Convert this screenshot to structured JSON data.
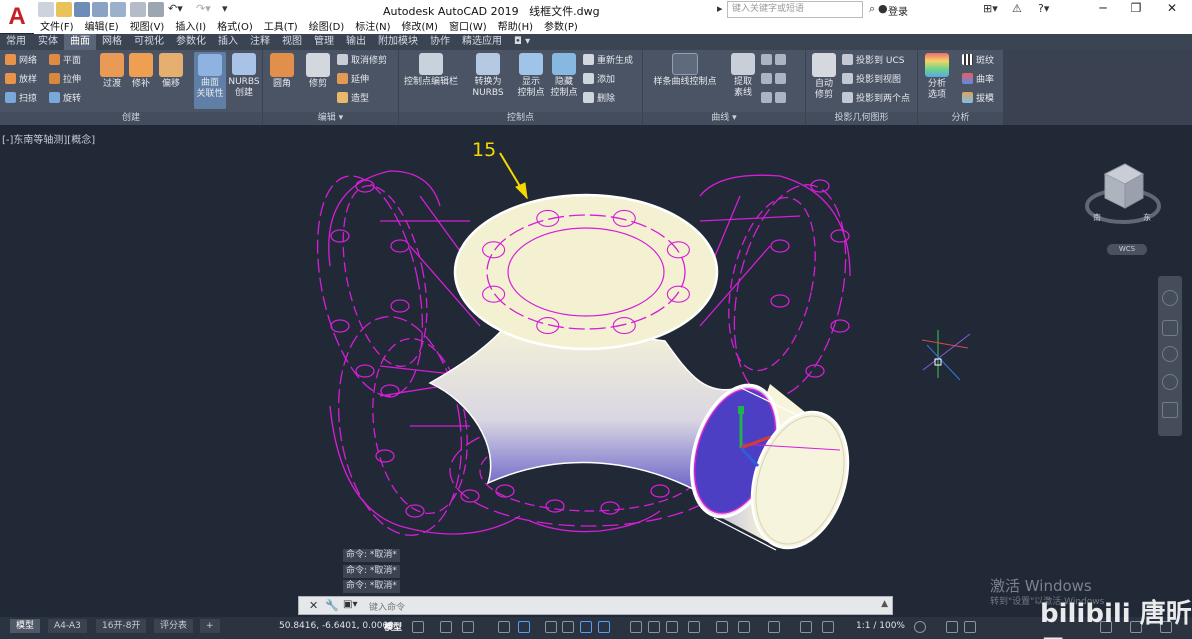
{
  "app": {
    "logo": "A",
    "title": "Autodesk AutoCAD 2019",
    "file": "线框文件.dwg",
    "search_placeholder": "键入关键字或短语",
    "login": "登录"
  },
  "menu": [
    "文件(F)",
    "编辑(E)",
    "视图(V)",
    "插入(I)",
    "格式(O)",
    "工具(T)",
    "绘图(D)",
    "标注(N)",
    "修改(M)",
    "窗口(W)",
    "帮助(H)",
    "参数(P)"
  ],
  "tabs": [
    {
      "label": "常用"
    },
    {
      "label": "实体"
    },
    {
      "label": "曲面",
      "active": true
    },
    {
      "label": "网格"
    },
    {
      "label": "可视化"
    },
    {
      "label": "参数化"
    },
    {
      "label": "插入"
    },
    {
      "label": "注释"
    },
    {
      "label": "视图"
    },
    {
      "label": "管理"
    },
    {
      "label": "输出"
    },
    {
      "label": "附加模块"
    },
    {
      "label": "协作"
    },
    {
      "label": "精选应用"
    }
  ],
  "ribbon": {
    "create": {
      "title": "创建",
      "small": [
        "网络",
        "平面",
        "放样",
        "拉伸",
        "扫掠",
        "旋转"
      ],
      "large": [
        "过渡",
        "修补",
        "偏移"
      ],
      "assoc": "曲面\n关联性",
      "nurbs": "NURBS\n创建"
    },
    "edit": {
      "title": "编辑",
      "fillet": "圆角",
      "trim": "修剪",
      "small": [
        "取消修剪",
        "延伸",
        "造型"
      ]
    },
    "cv": {
      "title": "控制点",
      "editbar": "控制点编辑栏",
      "convert": "转换为\nNURBS",
      "show": "显示\n控制点",
      "hide": "隐藏\n控制点",
      "small": [
        "重新生成",
        "添加",
        "删除"
      ]
    },
    "curves": {
      "title": "曲线",
      "spline": "样条曲线控制点",
      "extract": "提取\n素线"
    },
    "project": {
      "title": "投影几何图形",
      "auto": "自动\n修剪",
      "small": [
        "投影到 UCS",
        "投影到视图",
        "投影到两个点"
      ]
    },
    "analysis": {
      "title": "分析",
      "options": "分析\n选项",
      "small": [
        "斑纹",
        "曲率",
        "拔模"
      ]
    }
  },
  "viewport": {
    "label": "[-]东南等轴测][概念]",
    "annotation": "15",
    "cube_label": "WCS",
    "cube_dirs": [
      "南",
      "东"
    ]
  },
  "command": {
    "history": [
      "命令: *取消*",
      "命令: *取消*",
      "命令: *取消*"
    ],
    "placeholder": "键入命令"
  },
  "layouts": [
    {
      "label": "模型",
      "active": true
    },
    {
      "label": "A4-A3"
    },
    {
      "label": "16开-8开"
    },
    {
      "label": "评分表"
    },
    {
      "label": "+"
    }
  ],
  "status": {
    "coords": "50.8416, -6.6401, 0.0000",
    "space": "模型",
    "scale": "1:1 / 100%"
  },
  "watermark": {
    "activate": "激活 Windows",
    "hint": "转到\"设置\"以激活 Windows",
    "brand": "bilibili 唐昕晨"
  },
  "colors": {
    "wireframe": "#d41fd6",
    "surface": "#f4f1d3",
    "annotation": "#f5d800"
  }
}
